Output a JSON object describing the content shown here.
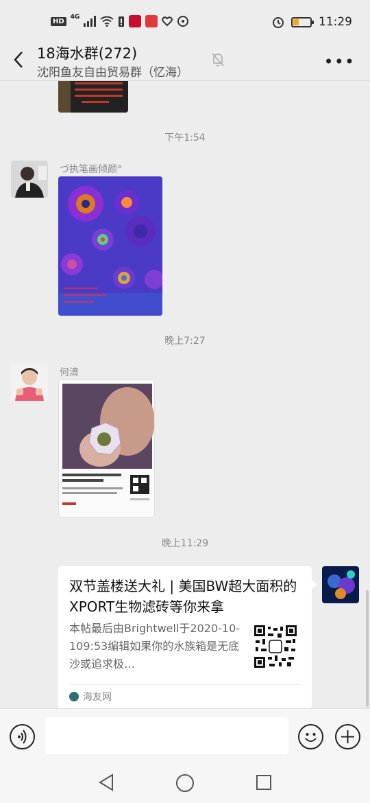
{
  "status_bar": {
    "hd": "HD",
    "network": "4G",
    "time": "11:29"
  },
  "header": {
    "title": "18海水群(272)",
    "subtitle": "沈阳鱼友自由贸易群（忆海）"
  },
  "messages": {
    "time_1": "下午1:54",
    "sender_1": "づ执笔画倾颜°",
    "time_2": "晚上7:27",
    "sender_2": "何清",
    "time_3": "晚上11:29"
  },
  "link_card": {
    "title": "双节盖楼送大礼 | 美国BW超大面积的XPORT生物滤砖等你来拿",
    "description": "本帖最后由Brightwell于2020-10-109:53编辑如果你的水族箱是无底沙或追求极…",
    "source": "海友网"
  },
  "colors": {
    "background": "#ededed",
    "bubble": "#ffffff",
    "battery_level": "#f5a623"
  }
}
